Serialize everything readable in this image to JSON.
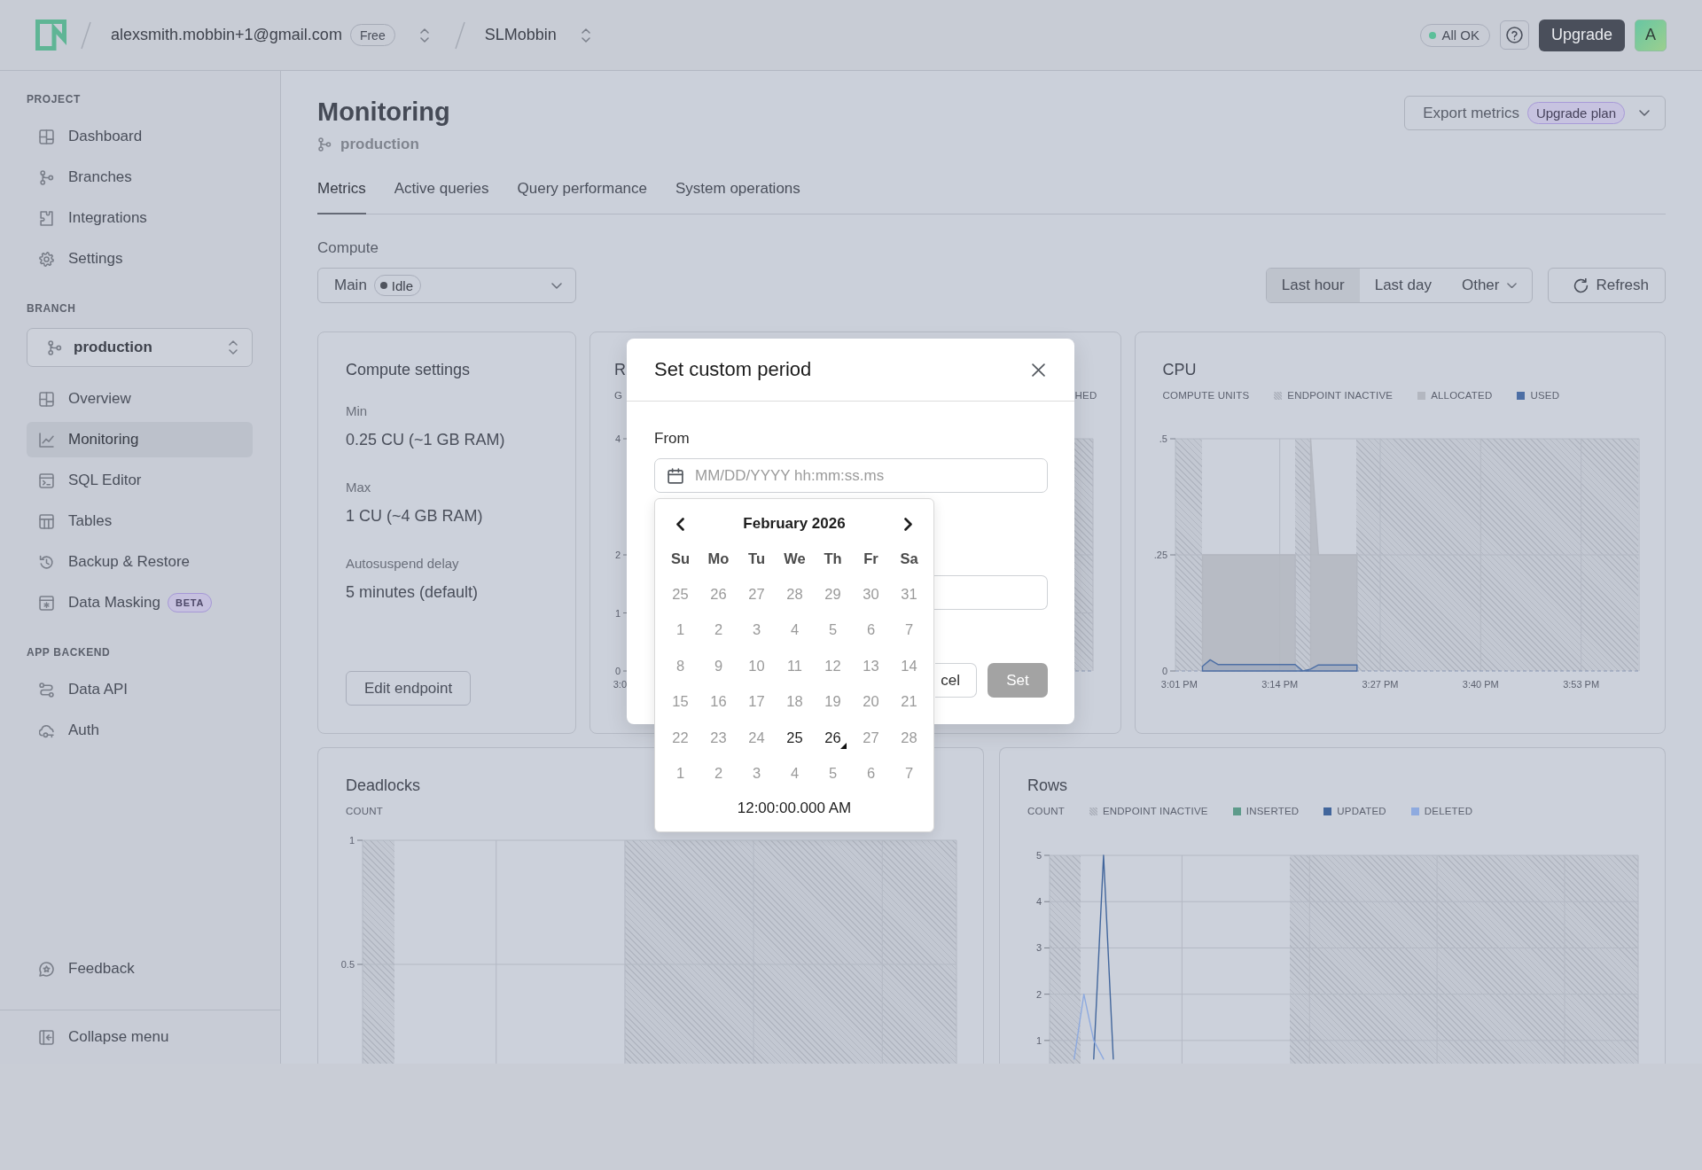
{
  "top_bar": {
    "account": {
      "email": "alexsmith.mobbin+1@gmail.com",
      "plan": "Free"
    },
    "project": {
      "name": "SLMobbin"
    },
    "status": {
      "label": "All OK"
    },
    "upgrade_button": {
      "label": "Upgrade"
    },
    "avatar": {
      "initial": "A"
    }
  },
  "sidebar": {
    "sections": [
      {
        "heading": "PROJECT",
        "items": [
          {
            "label": "Dashboard",
            "selected": false
          },
          {
            "label": "Branches",
            "selected": false
          },
          {
            "label": "Integrations",
            "selected": false
          },
          {
            "label": "Settings",
            "selected": false
          }
        ]
      },
      {
        "heading": "BRANCH",
        "branch_selector": {
          "value": "production"
        },
        "items": [
          {
            "label": "Overview",
            "selected": false
          },
          {
            "label": "Monitoring",
            "selected": true
          },
          {
            "label": "SQL Editor",
            "selected": false
          },
          {
            "label": "Tables",
            "selected": false
          },
          {
            "label": "Backup & Restore",
            "selected": false
          },
          {
            "label": "Data Masking",
            "selected": false,
            "badge": "BETA"
          }
        ]
      },
      {
        "heading": "APP BACKEND",
        "items": [
          {
            "label": "Data API",
            "selected": false
          },
          {
            "label": "Auth",
            "selected": false
          }
        ]
      }
    ],
    "footer": {
      "feedback": "Feedback",
      "collapse": "Collapse menu"
    }
  },
  "header": {
    "title": "Monitoring",
    "branch": "production",
    "export_button": {
      "label": "Export metrics",
      "badge": "Upgrade plan"
    }
  },
  "tabs": [
    {
      "label": "Metrics",
      "selected": true
    },
    {
      "label": "Active queries",
      "selected": false
    },
    {
      "label": "Query performance",
      "selected": false
    },
    {
      "label": "System operations",
      "selected": false
    }
  ],
  "toolbar": {
    "compute": {
      "label": "Compute",
      "value": "Main",
      "status": "Idle"
    },
    "period_options": [
      {
        "label": "Last hour",
        "selected": true,
        "kind": "option"
      },
      {
        "label": "Last day",
        "selected": false,
        "kind": "option"
      },
      {
        "label": "Other",
        "selected": false,
        "kind": "menu"
      }
    ],
    "refresh_button": {
      "label": "Refresh"
    }
  },
  "compute_settings": {
    "title": "Compute settings",
    "settings": [
      {
        "label": "Min",
        "value": "0.25 CU (~1 GB RAM)"
      },
      {
        "label": "Max",
        "value": "1 CU (~4 GB RAM)"
      },
      {
        "label": "Autosuspend delay",
        "value": "5 minutes (default)"
      }
    ],
    "button": {
      "label": "Edit endpoint"
    }
  },
  "charts": [
    {
      "kind": "obscured",
      "title": "R",
      "axis_title": "G",
      "legend_tail": "HED",
      "y_labels": [
        "4",
        "2",
        "1",
        "0"
      ],
      "x_label": "3:0"
    },
    {
      "kind": "full",
      "legend": [
        {
          "kind": "hatch",
          "label": "ENDPOINT INACTIVE"
        }
      ],
      "chart_data": {
        "type": "area",
        "title": "CPU",
        "ylabel": "COMPUTE UNITS",
        "categories": [
          "3:01 PM",
          null,
          null,
          null,
          null,
          null,
          null,
          null,
          null,
          null,
          null,
          null,
          null,
          "3:14 PM",
          null,
          null,
          null,
          null,
          null,
          null,
          null,
          null,
          null,
          null,
          null,
          null,
          "3:27 PM",
          null,
          null,
          null,
          null,
          null,
          null,
          null,
          null,
          null,
          null,
          null,
          null,
          "3:40 PM",
          null,
          null,
          null,
          null,
          null,
          null,
          null,
          null,
          null,
          null,
          null,
          null,
          "3:53 PM",
          null,
          null,
          null,
          null,
          null,
          null,
          null
        ],
        "ylim": [
          0,
          0.5
        ],
        "yticks": [
          0,
          {
            "value": 0.25,
            "label": ".25"
          },
          {
            "value": 0.5,
            "label": ".5"
          }
        ],
        "grid": true,
        "series": [
          {
            "name": "ALLOCATED",
            "color": "#b3b7c0",
            "values": [
              null,
              null,
              null,
              0.25,
              0.25,
              0.25,
              0.25,
              0.25,
              0.25,
              0.25,
              0.25,
              0.25,
              0.25,
              0.25,
              0.25,
              0.25,
              null,
              0.5,
              0.25,
              0.25,
              0.25,
              0.25,
              0.25,
              0.25,
              null,
              null,
              null,
              null,
              null,
              null,
              null,
              null,
              null,
              null,
              null,
              null,
              null,
              null,
              null,
              null,
              null,
              null,
              null,
              null,
              null,
              null,
              null,
              null,
              null,
              null,
              null,
              null,
              null,
              null,
              null,
              null,
              null,
              null,
              null,
              null
            ]
          },
          {
            "name": "USED",
            "color": "#4d6fa5",
            "values": [
              null,
              null,
              null,
              0.01,
              0.024,
              0.014,
              0.014,
              0.014,
              0.014,
              0.014,
              0.014,
              0.014,
              0.014,
              0.014,
              0.014,
              0.014,
              0,
              0.004,
              0.013,
              0.013,
              0.013,
              0.013,
              0.013,
              0.013,
              null,
              null,
              null,
              null,
              null,
              null,
              null,
              null,
              null,
              null,
              null,
              null,
              null,
              null,
              null,
              null,
              null,
              null,
              null,
              null,
              null,
              null,
              null,
              null,
              null,
              null,
              null,
              null,
              null,
              null,
              null,
              null,
              null,
              null,
              null,
              null
            ]
          }
        ]
      }
    },
    {
      "kind": "full",
      "chart_data": {
        "type": "line",
        "title": "Deadlocks",
        "ylabel": "COUNT",
        "categories": [
          null,
          null,
          null,
          null,
          null,
          null,
          null,
          null,
          null,
          null,
          null,
          null,
          null,
          null,
          null,
          null,
          null,
          null,
          null,
          null,
          null,
          null,
          null,
          null,
          null,
          null,
          null,
          null,
          null,
          null,
          null,
          null,
          null,
          null,
          null,
          null,
          null,
          null,
          null,
          null,
          null,
          null,
          null,
          null,
          null,
          null,
          null,
          null,
          null,
          null,
          null,
          null,
          null,
          null,
          null,
          null,
          null,
          null,
          null,
          null
        ],
        "ylim": [
          0.1,
          1
        ],
        "yticks": [
          0.5,
          1
        ],
        "grid": true
      }
    },
    {
      "kind": "full",
      "legend": [
        {
          "kind": "hatch",
          "label": "ENDPOINT INACTIVE"
        },
        {
          "kind": "swatch",
          "label": "INSERTED",
          "color": "#5e9b8b"
        }
      ],
      "chart_data": {
        "type": "line",
        "title": "Rows",
        "ylabel": "COUNT",
        "categories": [
          null,
          null,
          null,
          null,
          null,
          null,
          null,
          null,
          null,
          null,
          null,
          null,
          null,
          null,
          null,
          null,
          null,
          null,
          null,
          null,
          null,
          null,
          null,
          null,
          null,
          null,
          null,
          null,
          null,
          null,
          null,
          null,
          null,
          null,
          null,
          null,
          null,
          null,
          null,
          null,
          null,
          null,
          null,
          null,
          null,
          null,
          null,
          null,
          null,
          null,
          null,
          null,
          null,
          null,
          null,
          null,
          null,
          null,
          null,
          null
        ],
        "ylim": [
          0.5,
          5
        ],
        "yticks": [
          1,
          2,
          3,
          4,
          5
        ],
        "grid": true,
        "series": [
          {
            "name": "UPDATED",
            "color": "#42669c",
            "values": [
              null,
              null,
              null,
              null,
              0.6,
              5,
              0.6,
              null,
              null,
              null,
              null,
              null,
              null,
              null,
              null,
              null,
              null,
              null,
              null,
              null,
              null,
              null,
              null,
              null,
              null,
              null,
              null,
              null,
              null,
              null,
              null,
              null,
              null,
              null,
              null,
              null,
              null,
              null,
              null,
              null,
              null,
              null,
              null,
              null,
              null,
              null,
              null,
              null,
              null,
              null,
              null,
              null,
              null,
              null,
              null,
              null,
              null,
              null,
              null,
              null
            ]
          },
          {
            "name": "DELETED",
            "color": "#8eaadf",
            "values": [
              null,
              null,
              0.6,
              2,
              1,
              0.6,
              null,
              null,
              null,
              null,
              null,
              null,
              null,
              null,
              null,
              null,
              null,
              null,
              null,
              null,
              null,
              null,
              null,
              null,
              null,
              null,
              null,
              null,
              null,
              null,
              null,
              null,
              null,
              null,
              null,
              null,
              null,
              null,
              null,
              null,
              null,
              null,
              null,
              null,
              null,
              null,
              null,
              null,
              null,
              null,
              null,
              null,
              null,
              null,
              null,
              null,
              null,
              null,
              null,
              null
            ]
          }
        ]
      }
    }
  ],
  "modal": {
    "title": "Set custom period",
    "fields": [
      {
        "kind": "date",
        "label": "From",
        "placeholder": "MM/DD/YYYY hh:mm:ss.ms"
      },
      {
        "kind": "covered"
      }
    ],
    "calendar": {
      "month": "February 2026",
      "weekdays": [
        "Su",
        "Mo",
        "Tu",
        "We",
        "Th",
        "Fr",
        "Sa"
      ],
      "days": [
        {
          "label": "25",
          "disabled": true,
          "today": false
        },
        {
          "label": "26",
          "disabled": true,
          "today": false
        },
        {
          "label": "27",
          "disabled": true,
          "today": false
        },
        {
          "label": "28",
          "disabled": true,
          "today": false
        },
        {
          "label": "29",
          "disabled": true,
          "today": false
        },
        {
          "label": "30",
          "disabled": true,
          "today": false
        },
        {
          "label": "31",
          "disabled": true,
          "today": false
        },
        {
          "label": "1",
          "disabled": true,
          "today": false
        },
        {
          "label": "2",
          "disabled": true,
          "today": false
        },
        {
          "label": "3",
          "disabled": true,
          "today": false
        },
        {
          "label": "4",
          "disabled": true,
          "today": false
        },
        {
          "label": "5",
          "disabled": true,
          "today": false
        },
        {
          "label": "6",
          "disabled": true,
          "today": false
        },
        {
          "label": "7",
          "disabled": true,
          "today": false
        },
        {
          "label": "8",
          "disabled": true,
          "today": false
        },
        {
          "label": "9",
          "disabled": true,
          "today": false
        },
        {
          "label": "10",
          "disabled": true,
          "today": false
        },
        {
          "label": "11",
          "disabled": true,
          "today": false
        },
        {
          "label": "12",
          "disabled": true,
          "today": false
        },
        {
          "label": "13",
          "disabled": true,
          "today": false
        },
        {
          "label": "14",
          "disabled": true,
          "today": false
        },
        {
          "label": "15",
          "disabled": true,
          "today": false
        },
        {
          "label": "16",
          "disabled": true,
          "today": false
        },
        {
          "label": "17",
          "disabled": true,
          "today": false
        },
        {
          "label": "18",
          "disabled": true,
          "today": false
        },
        {
          "label": "19",
          "disabled": true,
          "today": false
        },
        {
          "label": "20",
          "disabled": true,
          "today": false
        },
        {
          "label": "21",
          "disabled": true,
          "today": false
        },
        {
          "label": "22",
          "disabled": true,
          "today": false
        },
        {
          "label": "23",
          "disabled": true,
          "today": false
        },
        {
          "label": "24",
          "disabled": true,
          "today": false
        },
        {
          "label": "25",
          "disabled": false,
          "today": false
        },
        {
          "label": "26",
          "disabled": false,
          "today": true
        },
        {
          "label": "27",
          "disabled": true,
          "today": false
        },
        {
          "label": "28",
          "disabled": true,
          "today": false
        },
        {
          "label": "1",
          "disabled": true,
          "today": false
        },
        {
          "label": "2",
          "disabled": true,
          "today": false
        },
        {
          "label": "3",
          "disabled": true,
          "today": false
        },
        {
          "label": "4",
          "disabled": true,
          "today": false
        },
        {
          "label": "5",
          "disabled": true,
          "today": false
        },
        {
          "label": "6",
          "disabled": true,
          "today": false
        },
        {
          "label": "7",
          "disabled": true,
          "today": false
        }
      ],
      "time": "12:00:00.000 AM"
    },
    "buttons": [
      {
        "label": "cel",
        "kind": "covered",
        "disabled": false
      },
      {
        "label": "Set",
        "kind": "primary",
        "disabled": true
      }
    ]
  }
}
